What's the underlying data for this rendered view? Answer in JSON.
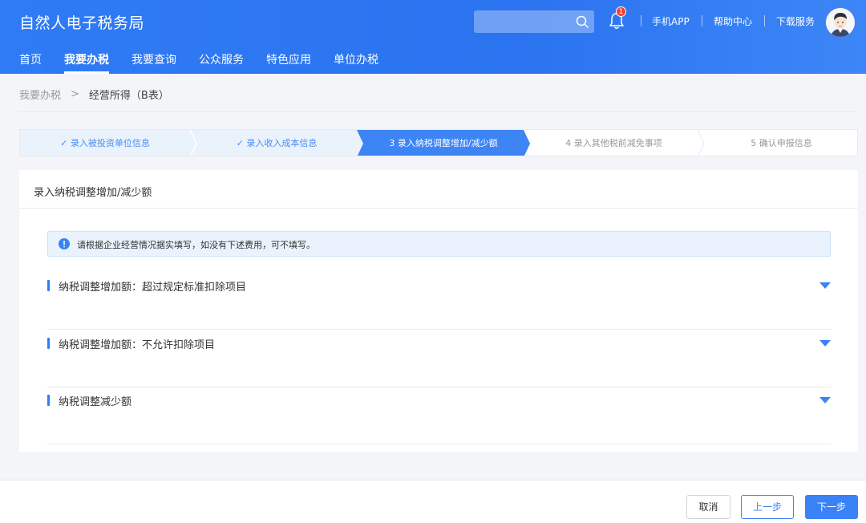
{
  "header": {
    "title": "自然人电子税务局",
    "search_placeholder": "",
    "notification_count": "1",
    "links": [
      "手机APP",
      "帮助中心",
      "下载服务"
    ]
  },
  "nav": {
    "items": [
      {
        "label": "首页",
        "active": false
      },
      {
        "label": "我要办税",
        "active": true
      },
      {
        "label": "我要查询",
        "active": false
      },
      {
        "label": "公众服务",
        "active": false
      },
      {
        "label": "特色应用",
        "active": false
      },
      {
        "label": "单位办税",
        "active": false
      }
    ]
  },
  "breadcrumb": {
    "root": "我要办税",
    "separator": ">",
    "current": "经营所得（B表）"
  },
  "steps": [
    {
      "label": "✓ 录入被投资单位信息",
      "state": "done"
    },
    {
      "label": "✓ 录入收入成本信息",
      "state": "done"
    },
    {
      "label": "3  录入纳税调整增加/减少额",
      "state": "active"
    },
    {
      "label": "4  录入其他税前减免事项",
      "state": "todo"
    },
    {
      "label": "5  确认申报信息",
      "state": "todo"
    }
  ],
  "card": {
    "title": "录入纳税调整增加/减少额",
    "notice": "请根据企业经营情况据实填写，如没有下述费用，可不填写。",
    "sections": [
      {
        "title": "纳税调整增加额：超过规定标准扣除项目"
      },
      {
        "title": "纳税调整增加额：不允许扣除项目"
      },
      {
        "title": "纳税调整减少额"
      }
    ]
  },
  "footer": {
    "cancel": "取消",
    "prev": "上一步",
    "next": "下一步"
  },
  "colors": {
    "primary": "#2f7bf5",
    "step_done_bg": "#eaf2fc",
    "step_active_bg": "#3d84f5"
  }
}
